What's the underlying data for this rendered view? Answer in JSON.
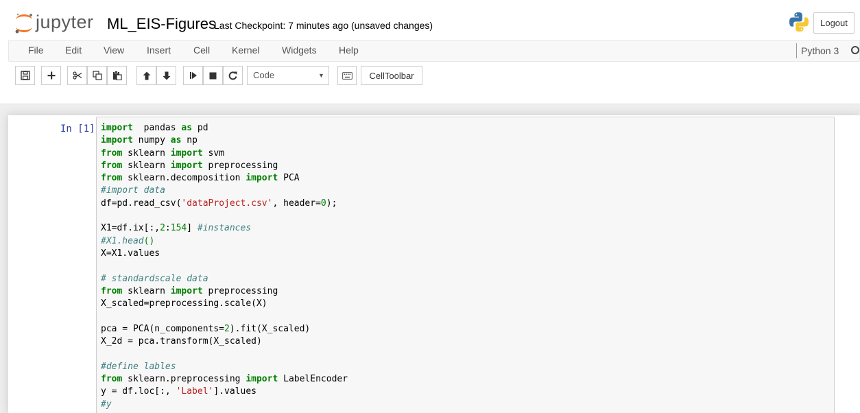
{
  "header": {
    "logo_text": "jupyter",
    "notebook_name": "ML_EIS-Figures",
    "checkpoint": "Last Checkpoint: 7 minutes ago (unsaved changes)",
    "logout_label": "Logout"
  },
  "menu": {
    "items": [
      "File",
      "Edit",
      "View",
      "Insert",
      "Cell",
      "Kernel",
      "Widgets",
      "Help"
    ],
    "kernel_name": "Python 3"
  },
  "toolbar": {
    "cell_type": "Code",
    "celltoolbar_label": "CellToolbar"
  },
  "cell": {
    "prompt": "In [1]:",
    "lines": [
      [
        [
          "kw",
          "import"
        ],
        [
          "",
          "  pandas "
        ],
        [
          "kw",
          "as"
        ],
        [
          "",
          " pd"
        ]
      ],
      [
        [
          "kw",
          "import"
        ],
        [
          "",
          " numpy "
        ],
        [
          "kw",
          "as"
        ],
        [
          "",
          " np"
        ]
      ],
      [
        [
          "kw",
          "from"
        ],
        [
          "",
          " sklearn "
        ],
        [
          "kw",
          "import"
        ],
        [
          "",
          " svm"
        ]
      ],
      [
        [
          "kw",
          "from"
        ],
        [
          "",
          " sklearn "
        ],
        [
          "kw",
          "import"
        ],
        [
          "",
          " preprocessing"
        ]
      ],
      [
        [
          "kw",
          "from"
        ],
        [
          "",
          " sklearn.decomposition "
        ],
        [
          "kw",
          "import"
        ],
        [
          "",
          " PCA"
        ]
      ],
      [
        [
          "cm",
          "#import data"
        ]
      ],
      [
        [
          "",
          "df=pd.read_csv("
        ],
        [
          "st",
          "'dataProject.csv'"
        ],
        [
          "",
          ", header="
        ],
        [
          "nm",
          "0"
        ],
        [
          "",
          ");"
        ]
      ],
      [
        [
          "",
          ""
        ]
      ],
      [
        [
          "",
          "X1=df.ix[:,"
        ],
        [
          "nm",
          "2"
        ],
        [
          "",
          ":"
        ],
        [
          "nm",
          "154"
        ],
        [
          "",
          "] "
        ],
        [
          "cm",
          "#instances"
        ]
      ],
      [
        [
          "cm",
          "#X1.head"
        ],
        [
          "nm",
          "()"
        ]
      ],
      [
        [
          "",
          "X=X1.values"
        ]
      ],
      [
        [
          "",
          ""
        ]
      ],
      [
        [
          "cm",
          "# standardscale data"
        ]
      ],
      [
        [
          "kw",
          "from"
        ],
        [
          "",
          " sklearn "
        ],
        [
          "kw",
          "import"
        ],
        [
          "",
          " preprocessing"
        ]
      ],
      [
        [
          "",
          "X_scaled=preprocessing.scale(X)"
        ]
      ],
      [
        [
          "",
          ""
        ]
      ],
      [
        [
          "",
          "pca = PCA(n_components="
        ],
        [
          "nm",
          "2"
        ],
        [
          "",
          ").fit(X_scaled)"
        ]
      ],
      [
        [
          "",
          "X_2d = pca.transform(X_scaled)"
        ]
      ],
      [
        [
          "",
          ""
        ]
      ],
      [
        [
          "cm",
          "#define lables"
        ]
      ],
      [
        [
          "kw",
          "from"
        ],
        [
          "",
          " sklearn.preprocessing "
        ],
        [
          "kw",
          "import"
        ],
        [
          "",
          " LabelEncoder"
        ]
      ],
      [
        [
          "",
          "y = df.loc[:, "
        ],
        [
          "st",
          "'Label'"
        ],
        [
          "",
          "].values"
        ]
      ],
      [
        [
          "cm",
          "#y"
        ]
      ]
    ]
  }
}
